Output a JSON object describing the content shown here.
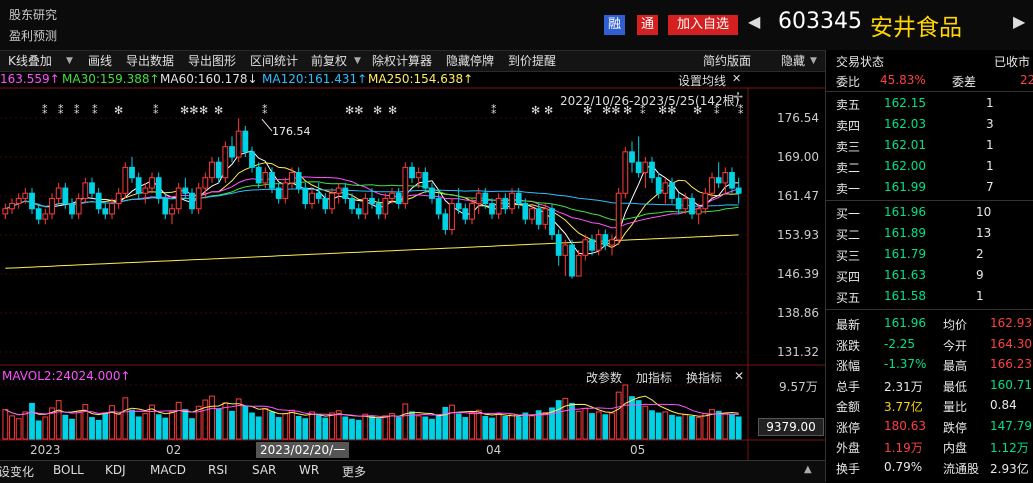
{
  "header": {
    "links": [
      "股东研究",
      "盈利预测"
    ],
    "rong": "融",
    "tong": "通",
    "add_watch": "加入自选",
    "code": "603345",
    "name": "安井食品"
  },
  "toolbar": {
    "items": [
      "K线叠加",
      "画线",
      "导出数据",
      "导出图形",
      "区间统计",
      "前复权",
      "除权计算器",
      "隐藏停牌",
      "到价提醒"
    ],
    "right": [
      "简约版面",
      "隐藏"
    ]
  },
  "ma_line": [
    {
      "text": "163.559↑",
      "color": "#ff50ff"
    },
    {
      "text": "MA30:159.388↑",
      "color": "#3fe03f"
    },
    {
      "text": "MA60:160.178↓",
      "color": "#e0e0e0"
    },
    {
      "text": "MA120:161.431↑",
      "color": "#27c0ff"
    },
    {
      "text": "MA250:154.638↑",
      "color": "#ffee55"
    }
  ],
  "set_ma": "设置均线",
  "range_text": "2022/10/26-2023/5/25(142根)",
  "peak_label": "176.54",
  "stars": [
    "⁑",
    "⁑",
    "⁑",
    "⁑",
    "✻",
    "⁑",
    "✻✻",
    "✻",
    "✻",
    "⁑",
    "✻✻",
    "✻",
    "✻",
    "⁑",
    "✻",
    "✻",
    "✻",
    "✻✻",
    "✻",
    "⁑",
    "✻✻",
    "✻"
  ],
  "y_labels": [
    "176.54",
    "169.00",
    "161.47",
    "153.93",
    "146.39",
    "138.86",
    "131.32"
  ],
  "vol": {
    "label": "MAVOL2:24024.000↑",
    "top_label": "9.57万",
    "current": "9379.00",
    "buttons": [
      "改参数",
      "加指标",
      "换指标"
    ],
    "close": "✕"
  },
  "x_labels": [
    "2023",
    "02",
    "04",
    "05"
  ],
  "cursor_date": "2023/02/20/一",
  "bottom_tabs": [
    "设变化",
    "BOLL",
    "KDJ",
    "MACD",
    "RSI",
    "SAR",
    "WR",
    "更多"
  ],
  "right": {
    "title": "交易状态",
    "status": "已收市",
    "weibi_label": "委比",
    "weibi": "45.83%",
    "weicha_label": "委差",
    "weicha": "22",
    "asks": [
      {
        "label": "卖五",
        "price": "162.15",
        "vol": "1"
      },
      {
        "label": "卖四",
        "price": "162.03",
        "vol": "3"
      },
      {
        "label": "卖三",
        "price": "162.01",
        "vol": "1"
      },
      {
        "label": "卖二",
        "price": "162.00",
        "vol": "1"
      },
      {
        "label": "卖一",
        "price": "161.99",
        "vol": "7"
      }
    ],
    "bids": [
      {
        "label": "买一",
        "price": "161.96",
        "vol": "10"
      },
      {
        "label": "买二",
        "price": "161.89",
        "vol": "13"
      },
      {
        "label": "买三",
        "price": "161.79",
        "vol": "2"
      },
      {
        "label": "买四",
        "price": "161.63",
        "vol": "9"
      },
      {
        "label": "买五",
        "price": "161.58",
        "vol": "1"
      }
    ],
    "stats": [
      {
        "l": "最新",
        "v": "161.96",
        "vc": "green",
        "l2": "均价",
        "v2": "162.93",
        "v2c": "red"
      },
      {
        "l": "涨跌",
        "v": "-2.25",
        "vc": "green",
        "l2": "今开",
        "v2": "164.30",
        "v2c": "red"
      },
      {
        "l": "涨幅",
        "v": "-1.37%",
        "vc": "green",
        "l2": "最高",
        "v2": "166.23",
        "v2c": "red"
      },
      {
        "l": "总手",
        "v": "2.31万",
        "vc": "white",
        "l2": "最低",
        "v2": "160.71",
        "v2c": "green"
      },
      {
        "l": "金额",
        "v": "3.77亿",
        "vc": "yellow",
        "l2": "量比",
        "v2": "0.84",
        "v2c": "white"
      },
      {
        "l": "涨停",
        "v": "180.63",
        "vc": "red",
        "l2": "跌停",
        "v2": "147.79",
        "v2c": "green"
      },
      {
        "l": "外盘",
        "v": "1.19万",
        "vc": "red",
        "l2": "内盘",
        "v2": "1.12万",
        "v2c": "green"
      },
      {
        "l": "换手",
        "v": "0.79%",
        "vc": "white",
        "l2": "流通股",
        "v2": "2.93亿",
        "v2c": "white"
      }
    ]
  },
  "chart_data": {
    "type": "candlestick",
    "y_ticks": [
      176.54,
      169.0,
      161.47,
      153.93,
      146.39,
      138.86,
      131.32
    ],
    "ohlc": [
      [
        158,
        160,
        157,
        159
      ],
      [
        159,
        161,
        158,
        160
      ],
      [
        160,
        162,
        159,
        161
      ],
      [
        161,
        163,
        160,
        162
      ],
      [
        162,
        163,
        158,
        159
      ],
      [
        159,
        160,
        156,
        157
      ],
      [
        157,
        159,
        156,
        158
      ],
      [
        158,
        162,
        157,
        161
      ],
      [
        161,
        164,
        160,
        163
      ],
      [
        163,
        164,
        159,
        160
      ],
      [
        160,
        161,
        157,
        158
      ],
      [
        158,
        162,
        157,
        161
      ],
      [
        161,
        165,
        160,
        164
      ],
      [
        164,
        165,
        161,
        162
      ],
      [
        162,
        163,
        158,
        159
      ],
      [
        159,
        160,
        157,
        158
      ],
      [
        158,
        161,
        157,
        160
      ],
      [
        160,
        163,
        159,
        162
      ],
      [
        162,
        168,
        161,
        167
      ],
      [
        167,
        169,
        164,
        165
      ],
      [
        165,
        166,
        161,
        162
      ],
      [
        162,
        164,
        160,
        163
      ],
      [
        163,
        166,
        162,
        165
      ],
      [
        165,
        166,
        160,
        161
      ],
      [
        161,
        162,
        157,
        158
      ],
      [
        158,
        160,
        156,
        159
      ],
      [
        159,
        164,
        158,
        163
      ],
      [
        163,
        165,
        161,
        162
      ],
      [
        162,
        163,
        158,
        159
      ],
      [
        159,
        164,
        158,
        163
      ],
      [
        163,
        166,
        161,
        165
      ],
      [
        165,
        169,
        164,
        168
      ],
      [
        168,
        169,
        164,
        165
      ],
      [
        165,
        172,
        164,
        171
      ],
      [
        171,
        173,
        168,
        169
      ],
      [
        169,
        176.5,
        168,
        174
      ],
      [
        174,
        175,
        169,
        170
      ],
      [
        170,
        171,
        166,
        167
      ],
      [
        167,
        168,
        163,
        164
      ],
      [
        164,
        167,
        163,
        166
      ],
      [
        166,
        167,
        162,
        163
      ],
      [
        163,
        164,
        160,
        161
      ],
      [
        161,
        165,
        160,
        164
      ],
      [
        164,
        167,
        163,
        166
      ],
      [
        166,
        167,
        162,
        163
      ],
      [
        163,
        164,
        159,
        160
      ],
      [
        160,
        163,
        159,
        162
      ],
      [
        162,
        164,
        160,
        161
      ],
      [
        161,
        162,
        158,
        159
      ],
      [
        159,
        163,
        158,
        162
      ],
      [
        162,
        164,
        160,
        163
      ],
      [
        163,
        164,
        160,
        161
      ],
      [
        161,
        162,
        158,
        159
      ],
      [
        159,
        160,
        157,
        158
      ],
      [
        158,
        162,
        157,
        161
      ],
      [
        161,
        163,
        159,
        160
      ],
      [
        160,
        161,
        157,
        158
      ],
      [
        158,
        162,
        157,
        161
      ],
      [
        161,
        163,
        160,
        162
      ],
      [
        162,
        163,
        159,
        160
      ],
      [
        160,
        168,
        159,
        167
      ],
      [
        167,
        168,
        164,
        165
      ],
      [
        165,
        167,
        163,
        166
      ],
      [
        166,
        167,
        162,
        163
      ],
      [
        163,
        164,
        160,
        161
      ],
      [
        161,
        162,
        157,
        158
      ],
      [
        158,
        159,
        154,
        155
      ],
      [
        155,
        161,
        154,
        160
      ],
      [
        160,
        163,
        158,
        159
      ],
      [
        159,
        160,
        156,
        157
      ],
      [
        157,
        161,
        156,
        160
      ],
      [
        160,
        163,
        158,
        162
      ],
      [
        162,
        163,
        159,
        160
      ],
      [
        160,
        161,
        157,
        158
      ],
      [
        158,
        162,
        157,
        161
      ],
      [
        161,
        162,
        158,
        159
      ],
      [
        159,
        163,
        158,
        162
      ],
      [
        162,
        163,
        159,
        160
      ],
      [
        160,
        161,
        156,
        157
      ],
      [
        157,
        160,
        156,
        159
      ],
      [
        159,
        160,
        155,
        156
      ],
      [
        156,
        160,
        155,
        159
      ],
      [
        159,
        160,
        153,
        154
      ],
      [
        154,
        155,
        148,
        150
      ],
      [
        150,
        153,
        146,
        152
      ],
      [
        152,
        153,
        145.5,
        146
      ],
      [
        146,
        151,
        146,
        150
      ],
      [
        150,
        154,
        149,
        153
      ],
      [
        153,
        154,
        150,
        151
      ],
      [
        151,
        155,
        150,
        154
      ],
      [
        154,
        155,
        151,
        152
      ],
      [
        152,
        154,
        150,
        153
      ],
      [
        153,
        163,
        152,
        162
      ],
      [
        162,
        171,
        161,
        170
      ],
      [
        170,
        172,
        166,
        168
      ],
      [
        168,
        173,
        165,
        166
      ],
      [
        166,
        169,
        163,
        168
      ],
      [
        168,
        169,
        164,
        165
      ],
      [
        165,
        166,
        161,
        162
      ],
      [
        162,
        165,
        160,
        164
      ],
      [
        164,
        165,
        160,
        161
      ],
      [
        161,
        162,
        158,
        159
      ],
      [
        159,
        162,
        158,
        161
      ],
      [
        161,
        162,
        157,
        158
      ],
      [
        158,
        160,
        156,
        159
      ],
      [
        159,
        163,
        158,
        162
      ],
      [
        162,
        166,
        161,
        165
      ],
      [
        165,
        168,
        163,
        164
      ],
      [
        164,
        167,
        162,
        166
      ],
      [
        166,
        167,
        162,
        163
      ],
      [
        163,
        165,
        160,
        162
      ]
    ],
    "volume": [
      5.2,
      4.1,
      3.6,
      4.8,
      6.3,
      3.2,
      3.9,
      5.5,
      6.8,
      4.2,
      3.5,
      4.9,
      6.1,
      3.8,
      3.3,
      4.6,
      5.9,
      4.4,
      7.3,
      5.1,
      3.9,
      4.5,
      6.0,
      4.3,
      3.7,
      4.8,
      6.5,
      5.2,
      3.6,
      5.8,
      6.9,
      7.6,
      5.3,
      6.4,
      4.9,
      7.1,
      5.8,
      4.6,
      3.9,
      5.4,
      4.8,
      3.8,
      4.5,
      5.1,
      4.0,
      3.6,
      4.8,
      4.2,
      3.7,
      4.6,
      5.0,
      3.9,
      3.5,
      3.3,
      4.4,
      4.0,
      3.6,
      4.1,
      4.5,
      3.8,
      6.2,
      4.8,
      4.1,
      3.9,
      3.5,
      4.3,
      5.6,
      6.0,
      4.4,
      3.8,
      4.7,
      5.1,
      4.0,
      3.7,
      4.5,
      4.0,
      4.4,
      3.9,
      4.6,
      4.1,
      5.0,
      4.7,
      5.5,
      6.8,
      7.2,
      6.3,
      4.9,
      5.4,
      4.5,
      4.8,
      4.3,
      4.6,
      8.3,
      9.57,
      7.5,
      6.8,
      5.8,
      5.0,
      4.6,
      4.8,
      4.2,
      3.9,
      4.3,
      4.0,
      3.8,
      4.5,
      5.2,
      4.9,
      4.6,
      4.3,
      3.9
    ]
  }
}
